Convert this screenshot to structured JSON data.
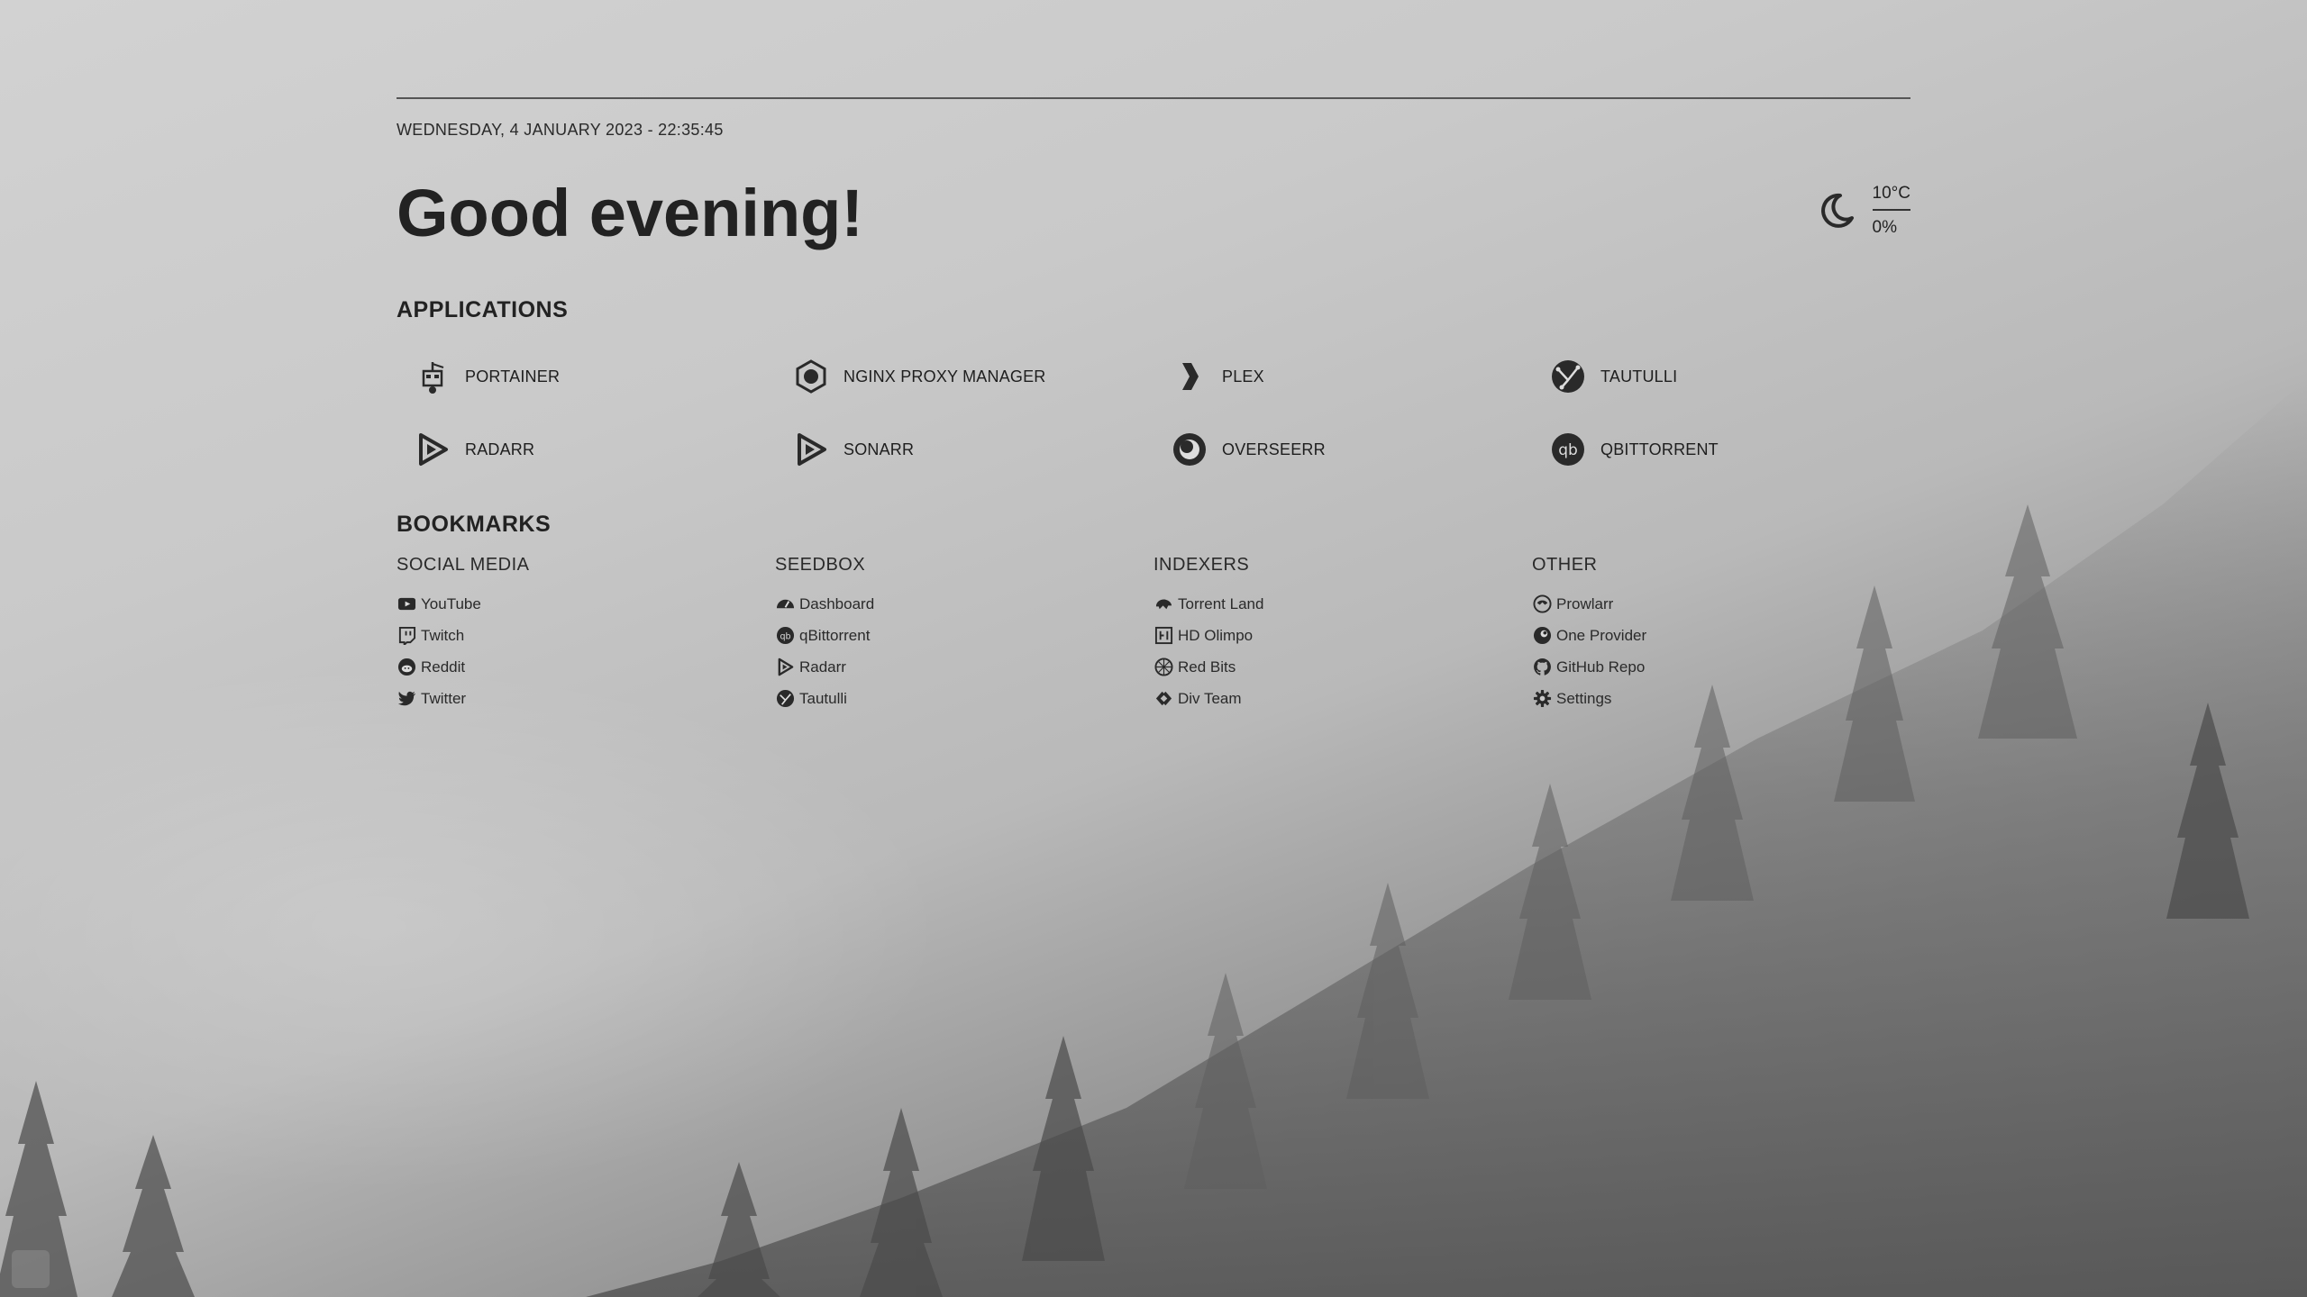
{
  "header": {
    "datetime": "WEDNESDAY, 4 JANUARY 2023 - 22:35:45",
    "greeting": "Good evening!"
  },
  "weather": {
    "icon": "moon-icon",
    "temperature": "10°C",
    "humidity": "0%"
  },
  "applications": {
    "title": "APPLICATIONS",
    "items": [
      {
        "label": "PORTAINER",
        "icon": "portainer-icon"
      },
      {
        "label": "NGINX PROXY MANAGER",
        "icon": "nginx-proxy-manager-icon"
      },
      {
        "label": "PLEX",
        "icon": "plex-icon"
      },
      {
        "label": "TAUTULLI",
        "icon": "tautulli-icon"
      },
      {
        "label": "RADARR",
        "icon": "radarr-icon"
      },
      {
        "label": "SONARR",
        "icon": "sonarr-icon"
      },
      {
        "label": "OVERSEERR",
        "icon": "overseerr-icon"
      },
      {
        "label": "QBITTORRENT",
        "icon": "qbittorrent-icon"
      }
    ]
  },
  "bookmarks": {
    "title": "BOOKMARKS",
    "groups": [
      {
        "title": "SOCIAL MEDIA",
        "items": [
          {
            "label": "YouTube",
            "icon": "youtube-icon"
          },
          {
            "label": "Twitch",
            "icon": "twitch-icon"
          },
          {
            "label": "Reddit",
            "icon": "reddit-icon"
          },
          {
            "label": "Twitter",
            "icon": "twitter-icon"
          }
        ]
      },
      {
        "title": "SEEDBOX",
        "items": [
          {
            "label": "Dashboard",
            "icon": "dashboard-gauge-icon"
          },
          {
            "label": "qBittorrent",
            "icon": "qbittorrent-icon"
          },
          {
            "label": "Radarr",
            "icon": "radarr-icon"
          },
          {
            "label": "Tautulli",
            "icon": "tautulli-icon"
          }
        ]
      },
      {
        "title": "INDEXERS",
        "items": [
          {
            "label": "Torrent Land",
            "icon": "torrent-land-icon"
          },
          {
            "label": "HD Olimpo",
            "icon": "hd-olimpo-icon"
          },
          {
            "label": "Red Bits",
            "icon": "red-bits-icon"
          },
          {
            "label": "Div Team",
            "icon": "div-team-icon"
          }
        ]
      },
      {
        "title": "OTHER",
        "items": [
          {
            "label": "Prowlarr",
            "icon": "prowlarr-icon"
          },
          {
            "label": "One Provider",
            "icon": "one-provider-icon"
          },
          {
            "label": "GitHub Repo",
            "icon": "github-icon"
          },
          {
            "label": "Settings",
            "icon": "gear-icon"
          }
        ]
      }
    ]
  }
}
